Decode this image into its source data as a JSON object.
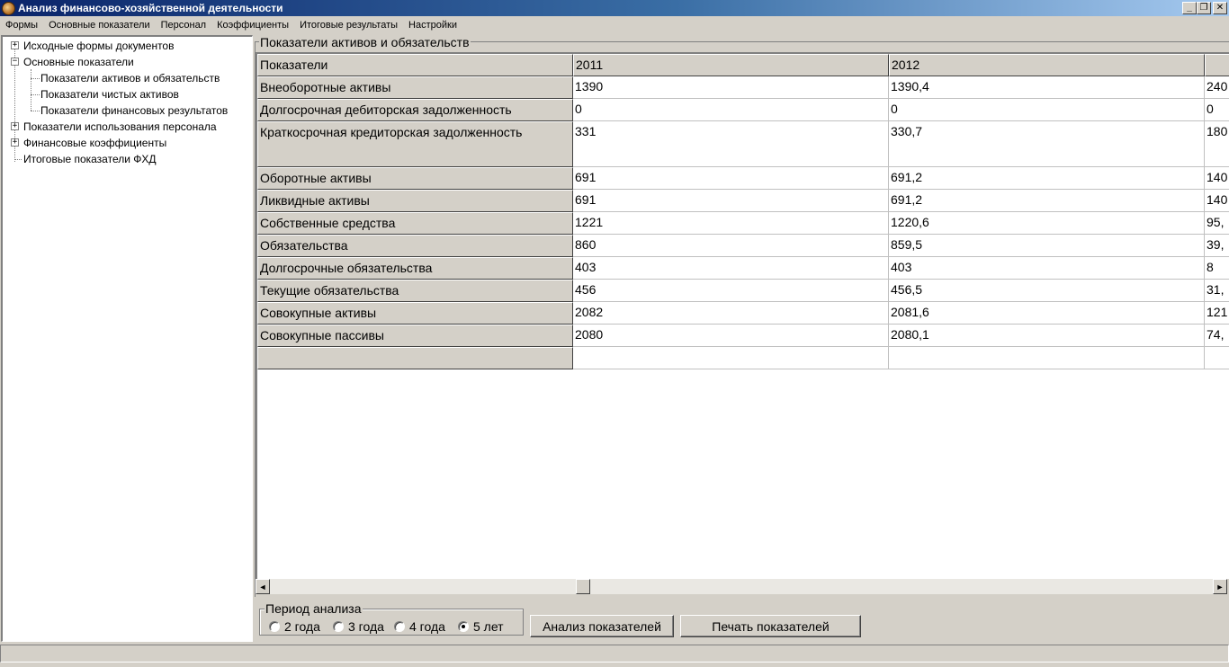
{
  "window": {
    "title": "Анализ финансово-хозяйственной деятельности",
    "buttons": {
      "minimize": "_",
      "restore": "❐",
      "close": "✕"
    }
  },
  "menu": [
    "Формы",
    "Основные показатели",
    "Персонал",
    "Коэффициенты",
    "Итоговые результаты",
    "Настройки"
  ],
  "tree": {
    "items": [
      {
        "label": "Исходные формы документов",
        "expander": "+"
      },
      {
        "label": "Основные показатели",
        "expander": "−"
      },
      {
        "label": "Показатели активов и обязательств"
      },
      {
        "label": "Показатели чистых активов"
      },
      {
        "label": "Показатели финансовых результатов"
      },
      {
        "label": "Показатели  использования персонала",
        "expander": "+"
      },
      {
        "label": "Финансовые коэффициенты",
        "expander": "+"
      },
      {
        "label": "Итоговые показатели ФХД"
      }
    ]
  },
  "group": {
    "title": "Показатели активов и обязательств"
  },
  "grid": {
    "headers": [
      "Показатели",
      "2011",
      "2012",
      ""
    ],
    "rows": [
      [
        "Внеоборотные активы",
        "1390",
        "1390,4",
        "240"
      ],
      [
        "Долгосрочная дебиторская задолженность",
        "0",
        "0",
        "0"
      ],
      [
        "Краткосрочная кредиторская задолженность",
        "331",
        "330,7",
        "180"
      ],
      [
        "Оборотные активы",
        "691",
        "691,2",
        "140"
      ],
      [
        "Ликвидные активы",
        "691",
        "691,2",
        "140"
      ],
      [
        "Собственные средства",
        "1221",
        "1220,6",
        "95,"
      ],
      [
        "Обязательства",
        "860",
        "859,5",
        "39,"
      ],
      [
        "Долгосрочные обязательства",
        "403",
        "403",
        "8"
      ],
      [
        "Текущие обязательства",
        "456",
        "456,5",
        "31,"
      ],
      [
        "Совокупные активы",
        "2082",
        "2081,6",
        "121"
      ],
      [
        "Совокупные пассивы",
        "2080",
        "2080,1",
        "74,"
      ],
      [
        "",
        "",
        "",
        ""
      ]
    ]
  },
  "scrollbar": {
    "left_arrow": "◄",
    "right_arrow": "►"
  },
  "period": {
    "title": "Период анализа",
    "options": [
      "2 года",
      "3 года",
      "4 года",
      "5 лет"
    ],
    "selected": "5 лет"
  },
  "buttons": {
    "analyze": "Анализ показателей",
    "print": "Печать показателей"
  }
}
